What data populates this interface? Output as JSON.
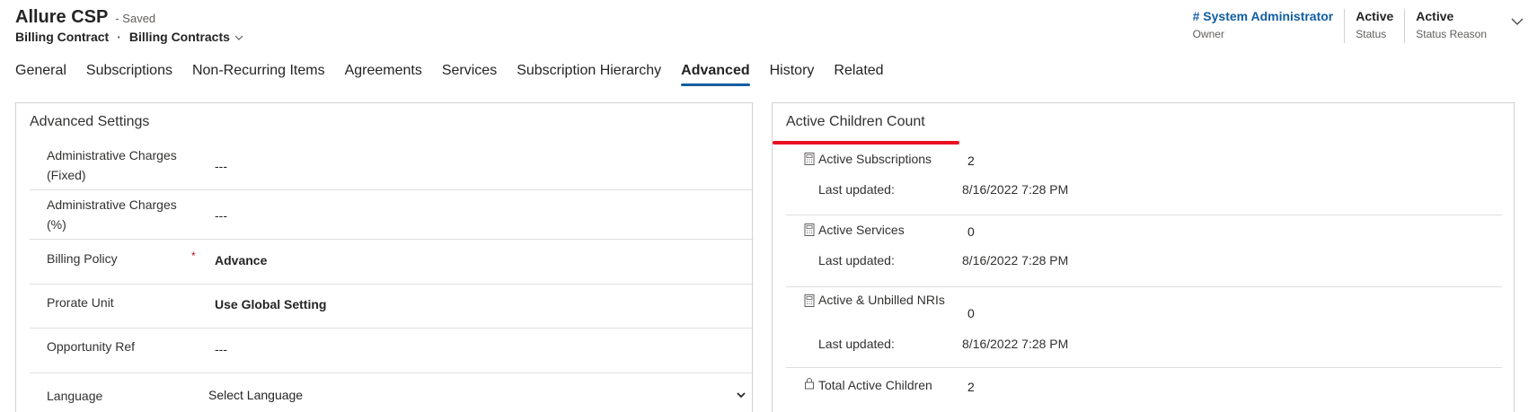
{
  "header": {
    "record_title": "Allure CSP",
    "saved_status": "- Saved",
    "breadcrumb": {
      "entity": "Billing Contract",
      "separator": "·",
      "form_name": "Billing Contracts"
    },
    "fields": [
      {
        "value": "# System Administrator",
        "label": "Owner"
      },
      {
        "value": "Active",
        "label": "Status"
      },
      {
        "value": "Active",
        "label": "Status Reason"
      }
    ],
    "icons": {
      "form_selector": "chevron-down-icon",
      "expand": "chevron-down-icon"
    }
  },
  "tabs": [
    {
      "label": "General"
    },
    {
      "label": "Subscriptions"
    },
    {
      "label": "Non-Recurring Items"
    },
    {
      "label": "Agreements"
    },
    {
      "label": "Services"
    },
    {
      "label": "Subscription Hierarchy"
    },
    {
      "label": "Advanced"
    },
    {
      "label": "History"
    },
    {
      "label": "Related"
    }
  ],
  "active_tab": "Advanced",
  "advanced_settings": {
    "title": "Advanced Settings",
    "rows": [
      {
        "label": "Administrative Charges (Fixed)",
        "value": "---"
      },
      {
        "label": "Administrative Charges (%)",
        "value": "---"
      },
      {
        "label": "Billing Policy",
        "required_mark": "*",
        "value": "Advance"
      },
      {
        "label": "Prorate Unit",
        "value": "Use Global Setting"
      },
      {
        "label": "Opportunity Ref",
        "value": "---"
      },
      {
        "label": "Language",
        "value": "Select Language"
      }
    ]
  },
  "active_children_count": {
    "title": "Active Children Count",
    "items": [
      {
        "icon": "calculator-icon",
        "label": "Active Subscriptions",
        "value": "2",
        "sub_label": "Last updated:",
        "sub_value": "8/16/2022 7:28 PM"
      },
      {
        "icon": "calculator-icon",
        "label": "Active Services",
        "value": "0",
        "sub_label": "Last updated:",
        "sub_value": "8/16/2022 7:28 PM"
      },
      {
        "icon": "calculator-icon",
        "label": "Active & Unbilled NRIs",
        "value": "0",
        "sub_label": "Last updated:",
        "sub_value": "8/16/2022 7:28 PM"
      },
      {
        "icon": "lock-icon",
        "label": "Total Active Children",
        "value": "2"
      }
    ]
  },
  "colors": {
    "accent": "#115ea3",
    "annotation_red": "#e81123",
    "required": "#c50f1f",
    "border": "#d1d1d1"
  }
}
